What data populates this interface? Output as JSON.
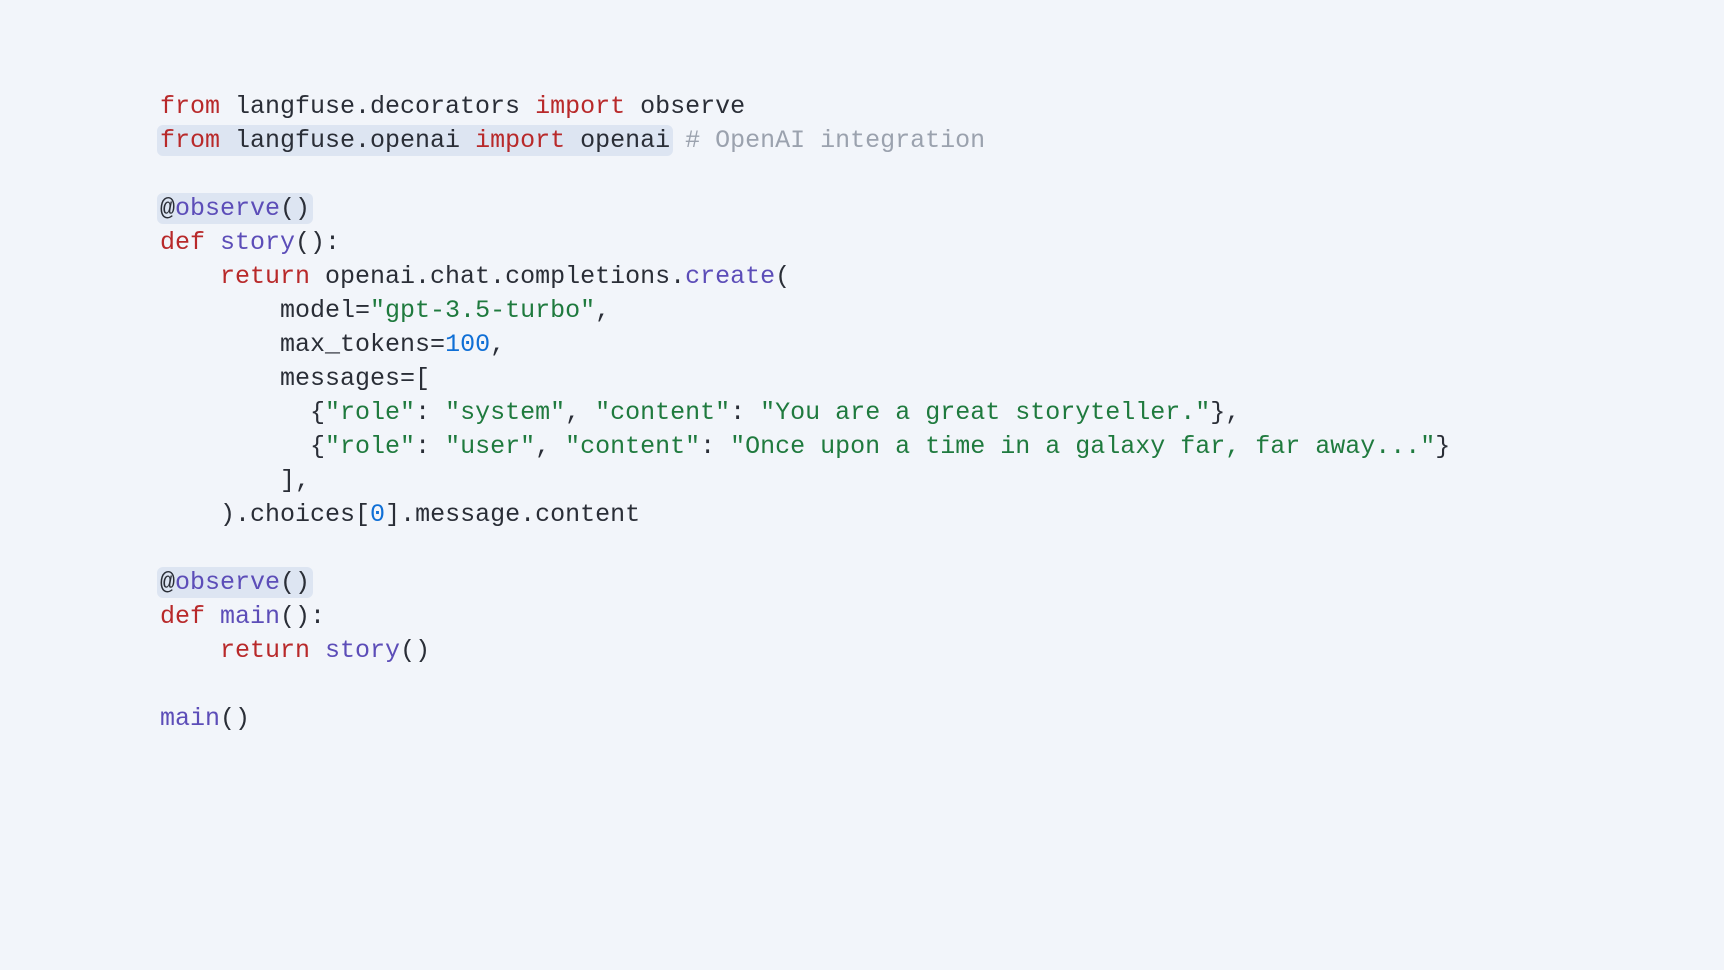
{
  "code": {
    "line1": {
      "from": "from",
      "module": " langfuse.decorators ",
      "import": "import",
      "name": " observe"
    },
    "line2": {
      "from": "from",
      "module": " langfuse.openai ",
      "import": "import",
      "name": " openai",
      "comment": " # OpenAI integration"
    },
    "line4": {
      "decorator_at": "@",
      "decorator_name": "observe",
      "decorator_parens": "()"
    },
    "line5": {
      "def": "def",
      "space": " ",
      "name": "story",
      "parens": "():"
    },
    "line6": {
      "indent": "    ",
      "return": "return",
      "rest1": " openai.chat.completions.",
      "create": "create",
      "open": "("
    },
    "line7": {
      "indent": "        ",
      "key": "model=",
      "val": "\"gpt-3.5-turbo\"",
      "end": ","
    },
    "line8": {
      "indent": "        ",
      "key": "max_tokens=",
      "val": "100",
      "end": ","
    },
    "line9": {
      "indent": "        ",
      "text": "messages=["
    },
    "line10": {
      "indent": "          ",
      "open": "{",
      "k1": "\"role\"",
      "c1": ": ",
      "v1": "\"system\"",
      "c2": ", ",
      "k2": "\"content\"",
      "c3": ": ",
      "v2": "\"You are a great storyteller.\"",
      "close": "},"
    },
    "line11": {
      "indent": "          ",
      "open": "{",
      "k1": "\"role\"",
      "c1": ": ",
      "v1": "\"user\"",
      "c2": ", ",
      "k2": "\"content\"",
      "c3": ": ",
      "v2": "\"Once upon a time in a galaxy far, far away...\"",
      "close": "}"
    },
    "line12": {
      "indent": "        ",
      "text": "],"
    },
    "line13": {
      "indent": "    ",
      "text1": ").choices[",
      "num": "0",
      "text2": "].message.content"
    },
    "line15": {
      "decorator_at": "@",
      "decorator_name": "observe",
      "decorator_parens": "()"
    },
    "line16": {
      "def": "def",
      "space": " ",
      "name": "main",
      "parens": "():"
    },
    "line17": {
      "indent": "    ",
      "return": "return",
      "space": " ",
      "call": "story",
      "parens": "()"
    },
    "line19": {
      "call": "main",
      "parens": "()"
    }
  }
}
